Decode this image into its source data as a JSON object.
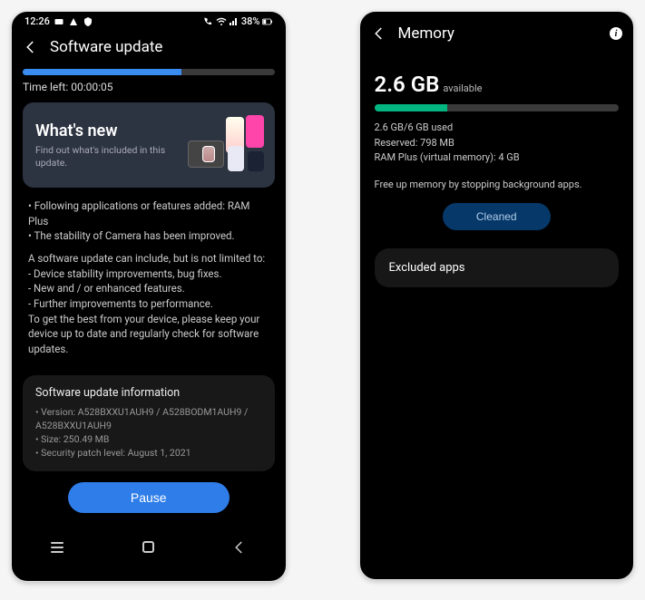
{
  "phone1": {
    "status": {
      "time": "12:26",
      "battery": "38%"
    },
    "header": {
      "title": "Software update"
    },
    "progress": {
      "percent": 63,
      "time_left": "Time left: 00:00:05"
    },
    "whats_new": {
      "title": "What's new",
      "subtitle": "Find out what's included in this update."
    },
    "release_notes": {
      "p1": "• Following applications or features added: RAM Plus\n• The stability of Camera has been improved.",
      "p2": "A software update can include, but is not limited to:\n - Device stability improvements, bug fixes.\n - New and / or enhanced features.\n - Further improvements to performance.\nTo get the best from your device, please keep your device up to date and regularly check for software updates."
    },
    "info_card": {
      "title": "Software update information",
      "body": "• Version: A528BXXU1AUH9 / A528BODM1AUH9 /\n  A528BXXU1AUH9\n• Size: 250.49 MB\n• Security patch level: August 1, 2021"
    },
    "pause_label": "Pause"
  },
  "phone2": {
    "header": {
      "title": "Memory"
    },
    "available": {
      "value": "2.6 GB",
      "label": "available"
    },
    "bar_percent": 30,
    "lines": {
      "used": "2.6 GB/6 GB used",
      "reserved": "Reserved: 798 MB",
      "ram_plus": "RAM Plus (virtual memory): 4 GB"
    },
    "free_up": "Free up memory by stopping background apps.",
    "cleaned_label": "Cleaned",
    "excluded_label": "Excluded apps"
  }
}
